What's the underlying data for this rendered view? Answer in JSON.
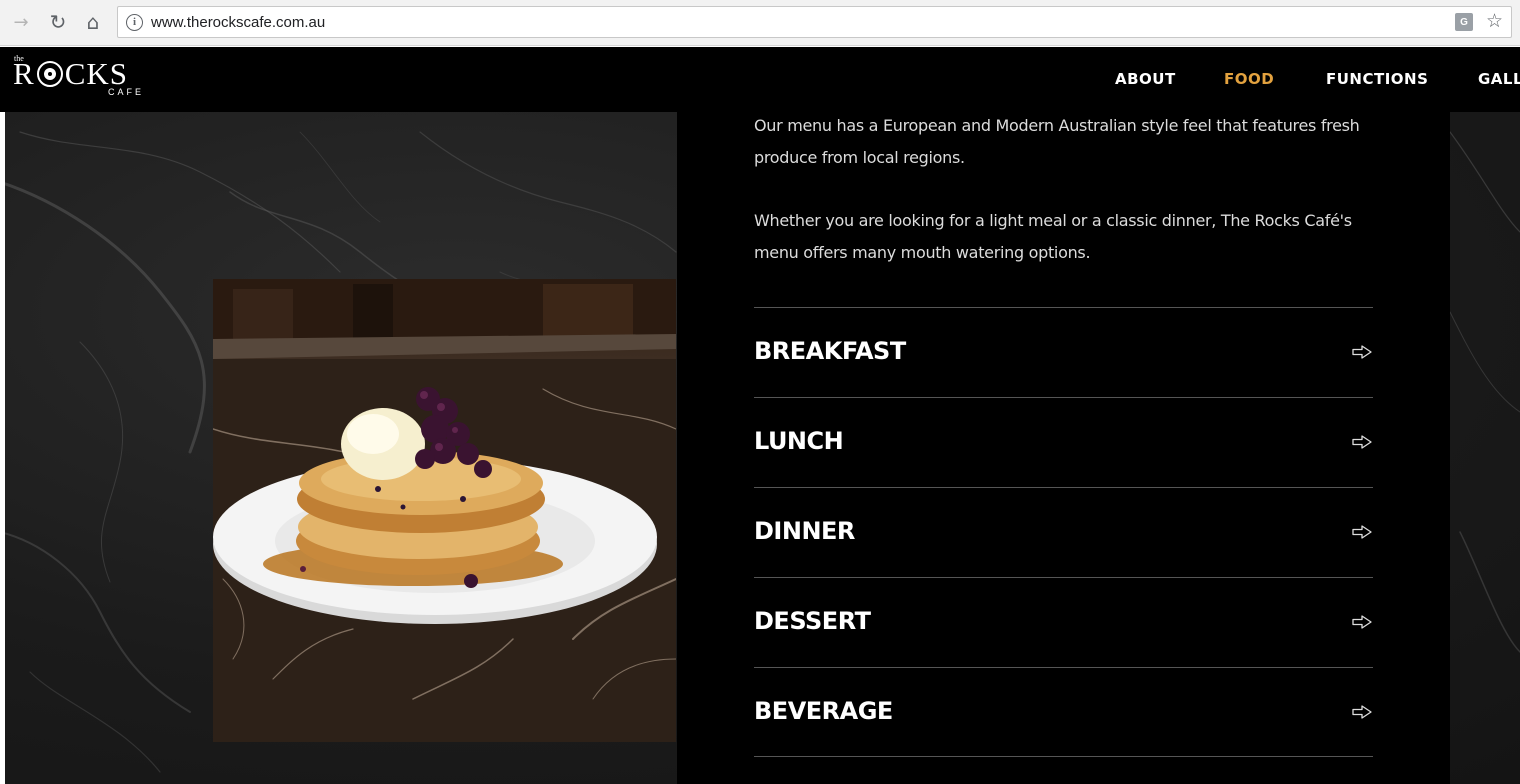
{
  "browser": {
    "url": "www.therockscafe.com.au",
    "info_symbol": "i",
    "translate_symbol": "G"
  },
  "header": {
    "logo": {
      "top_text": "the",
      "main_left": "R",
      "main_right": "CKS",
      "sub_text": "CAFE"
    },
    "nav": [
      {
        "label": "ABOUT",
        "active": false
      },
      {
        "label": "FOOD",
        "active": true
      },
      {
        "label": "FUNCTIONS",
        "active": false
      },
      {
        "label": "GALLERY",
        "active": false
      }
    ]
  },
  "content": {
    "intro_paragraphs": [
      "Our menu has a European and Modern Australian style feel that features fresh produce from local regions.",
      "Whether you are looking for a light meal or a classic dinner, The Rocks Café's menu offers many mouth watering options."
    ],
    "menu_items": [
      {
        "label": "BREAKFAST"
      },
      {
        "label": "LUNCH"
      },
      {
        "label": "DINNER"
      },
      {
        "label": "DESSERT"
      },
      {
        "label": "BEVERAGE"
      }
    ]
  },
  "colors": {
    "accent": "#e3a23f",
    "header_bg": "#000000",
    "panel_bg": "#000000",
    "text_light": "#dcdcdc",
    "divider": "#555555"
  }
}
